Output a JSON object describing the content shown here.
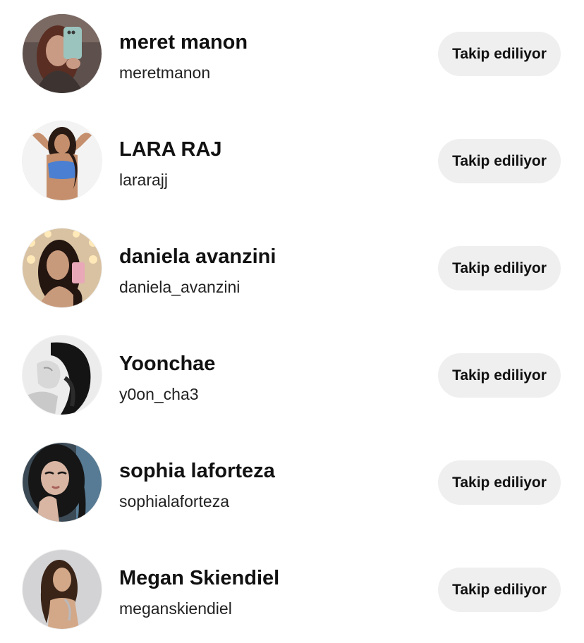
{
  "following_list": {
    "users": [
      {
        "display_name": "meret manon",
        "username": "meretmanon",
        "action_label": "Takip ediliyor",
        "avatar": {
          "bg": "#6a5a55",
          "hair": "#5a2e22",
          "skin": "#c99a84",
          "accent": "#9bc4bf",
          "style": "mirror-selfie"
        }
      },
      {
        "display_name": "LARA RAJ",
        "username": "lararajj",
        "action_label": "Takip ediliyor",
        "avatar": {
          "bg": "#f2f2f2",
          "hair": "#2a1a14",
          "skin": "#c58f6d",
          "accent": "#4a7fd1",
          "style": "pose"
        }
      },
      {
        "display_name": "daniela avanzini",
        "username": "daniela_avanzini",
        "action_label": "Takip ediliyor",
        "avatar": {
          "bg": "#d8c2a2",
          "hair": "#231510",
          "skin": "#c89a7c",
          "accent": "#ffe9b8",
          "style": "vanity"
        }
      },
      {
        "display_name": "Yoonchae",
        "username": "y0on_cha3",
        "action_label": "Takip ediliyor",
        "avatar": {
          "bg": "#e9e9e9",
          "hair": "#141414",
          "skin": "#d8d8d8",
          "accent": "#9a9a9a",
          "style": "monochrome"
        }
      },
      {
        "display_name": "sophia laforteza",
        "username": "sophialaforteza",
        "action_label": "Takip ediliyor",
        "avatar": {
          "bg": "#3b4a55",
          "hair": "#161616",
          "skin": "#d9b6a3",
          "accent": "#6fa4c8",
          "style": "closeup"
        }
      },
      {
        "display_name": "Megan Skiendiel",
        "username": "meganskiendiel",
        "action_label": "Takip ediliyor",
        "avatar": {
          "bg": "#d3d3d5",
          "hair": "#3a2418",
          "skin": "#d3a888",
          "accent": "#b9b9bd",
          "style": "portrait"
        }
      }
    ]
  }
}
